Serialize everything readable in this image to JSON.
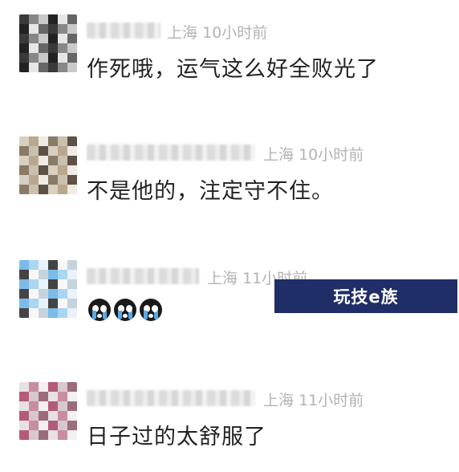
{
  "comments": [
    {
      "location": "上海",
      "time": "10小时前",
      "text": "作死哦，运气这么好全败光了"
    },
    {
      "location": "上海",
      "time": "10小时前",
      "text": "不是他的，注定守不住。"
    },
    {
      "location": "上海",
      "time": "11小时前",
      "text": "",
      "emoji_icon": "crying-face-icon"
    },
    {
      "location": "上海",
      "time": "11小时前",
      "text": "日子过的太舒服了"
    }
  ],
  "watermark": {
    "label": "玩技e族",
    "color": "#1f2e66"
  }
}
